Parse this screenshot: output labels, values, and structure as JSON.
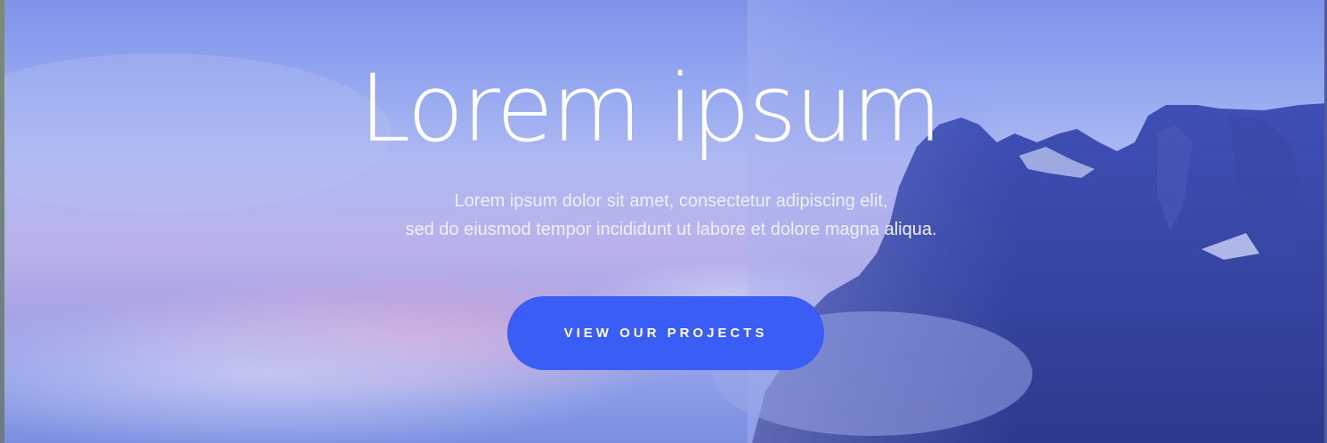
{
  "hero": {
    "title": "Lorem ipsum",
    "subtitle_line1": "Lorem ipsum dolor sit amet, consectetur adipiscing elit,",
    "subtitle_line2": "sed do eiusmod tempor incididunt ut labore et dolore magna aliqua.",
    "cta_label": "VIEW OUR PROJECTS"
  },
  "colors": {
    "accent": "#3a5ef5",
    "text": "#ffffff"
  }
}
